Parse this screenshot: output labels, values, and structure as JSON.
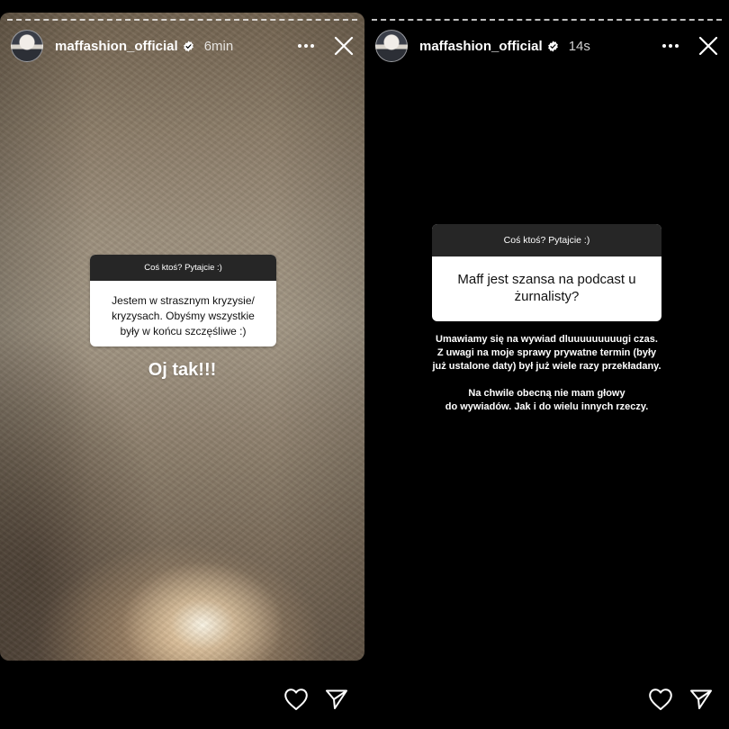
{
  "stories": [
    {
      "username": "maffashion_official",
      "time": "6min",
      "question_title": "Coś ktoś? Pytajcie :)",
      "question_lines": [
        "Jestem w strasznym kryzysie/",
        "kryzysach. Obyśmy wszystkie",
        "były w końcu szczęśliwe :)"
      ],
      "reply": "Oj tak!!!"
    },
    {
      "username": "maffashion_official",
      "time": "14s",
      "question_title": "Coś ktoś? Pytajcie :)",
      "question_lines": [
        "Maff jest szansa na podcast u",
        "żurnalisty?"
      ],
      "answer_paragraph_1": [
        "Umawiamy się na wywiad dluuuuuuuuugi czas.",
        "Z uwagi na moje sprawy prywatne termin (były",
        "już ustalone daty) był już wiele razy przekładany."
      ],
      "answer_paragraph_2": [
        "Na chwile obecną nie mam głowy",
        "do wywiadów. Jak i do wielu innych rzeczy."
      ]
    }
  ],
  "icons": {
    "verified": "verified-badge-icon",
    "more": "more-horizontal-icon",
    "close": "close-icon",
    "like": "heart-icon",
    "share": "send-icon"
  },
  "colors": {
    "background": "#000000",
    "question_header": "#262626",
    "question_body": "#ffffff"
  }
}
